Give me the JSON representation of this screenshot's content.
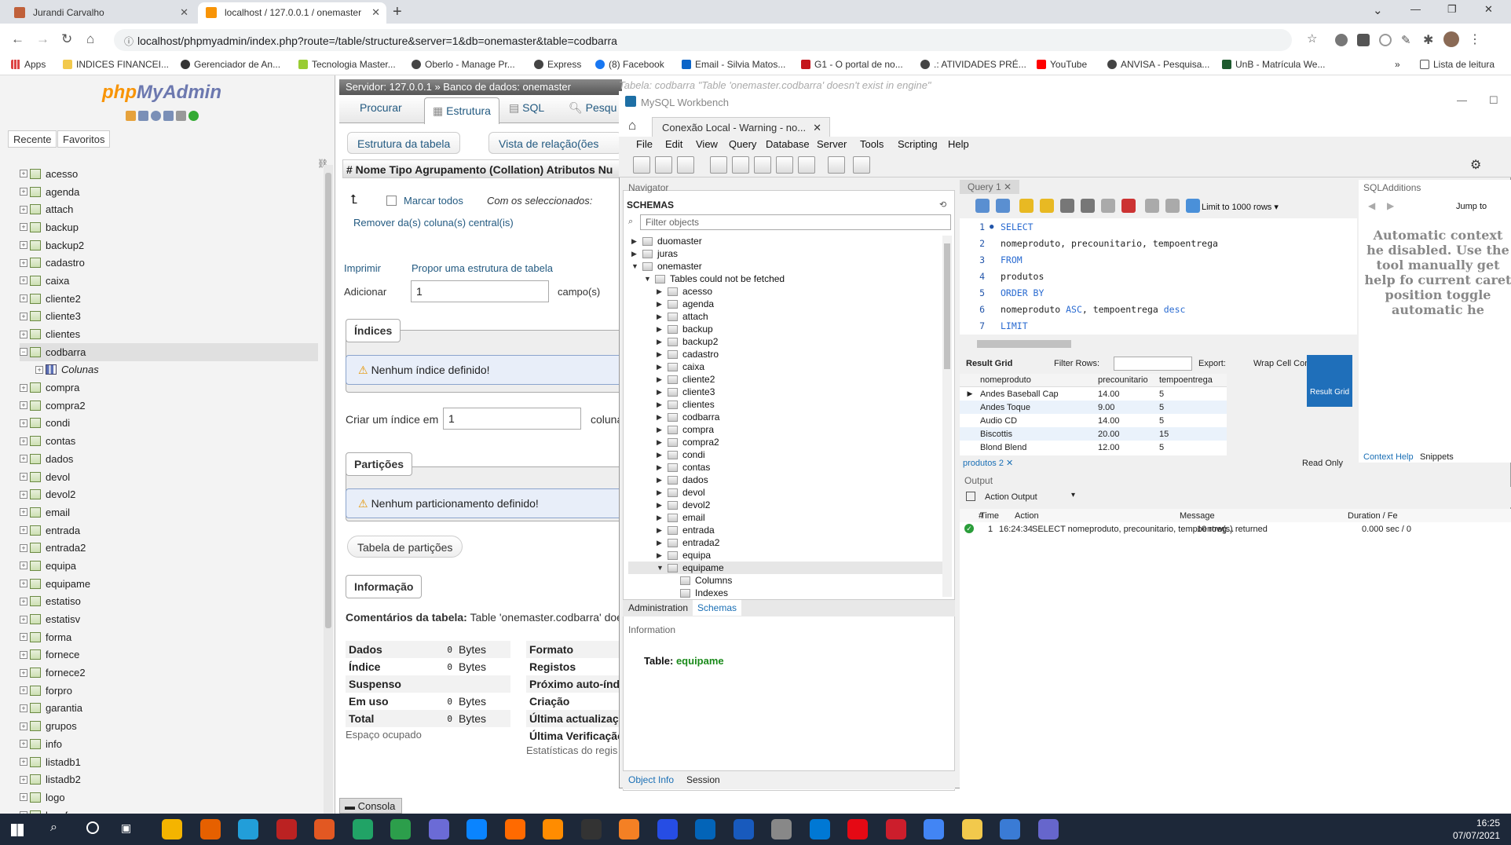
{
  "browser": {
    "tabs": [
      {
        "title": "Jurandi Carvalho"
      },
      {
        "title": "localhost / 127.0.0.1 / onemaster"
      }
    ],
    "url": "localhost/phpmyadmin/index.php?route=/table/structure&server=1&db=onemaster&table=codbarra",
    "bookmarks": [
      "Apps",
      "INDICES FINANCEI...",
      "Gerenciador de An...",
      "Tecnologia Master...",
      "Oberlo - Manage Pr...",
      "Express",
      "(8) Facebook",
      "Email - Silvia Matos...",
      "G1 - O portal de no...",
      ".: ATIVIDADES PRÉ...",
      "YouTube",
      "ANVISA - Pesquisa...",
      "UnB - Matrícula We..."
    ],
    "reading_list": "Lista de leitura"
  },
  "pma": {
    "logo": {
      "php": "php",
      "my": "MyAdmin"
    },
    "recent": "Recente",
    "favorites": "Favoritos",
    "tree": [
      "acesso",
      "agenda",
      "attach",
      "backup",
      "backup2",
      "cadastro",
      "caixa",
      "cliente2",
      "cliente3",
      "clientes",
      "codbarra",
      "Colunas",
      "compra",
      "compra2",
      "condi",
      "contas",
      "dados",
      "devol",
      "devol2",
      "email",
      "entrada",
      "entrada2",
      "equipa",
      "equipame",
      "estatiso",
      "estatisv",
      "forma",
      "fornece",
      "fornece2",
      "forpro",
      "garantia",
      "grupos",
      "info",
      "listadb1",
      "listadb2",
      "logo",
      "logof"
    ],
    "server_bar": "Servidor: 127.0.0.1 » Banco de dados: onemaster",
    "tabs": {
      "browse": "Procurar",
      "structure": "Estrutura",
      "sql": "SQL",
      "search": "Pesqu"
    },
    "sub_tabs": {
      "table_structure": "Estrutura da tabela",
      "relations": "Vista de relação(ões"
    },
    "columns_header": "#  Nome  Tipo  Agrupamento (Collation)  Atributos  Nu",
    "check_all": "Marcar todos",
    "with_selected": "Com os seleccionados:",
    "remove_central": "Remover da(s) coluna(s) central(is)",
    "print": "Imprimir",
    "propose": "Propor uma estrutura de tabela",
    "add": "Adicionar",
    "add_value": "1",
    "fields": "campo(s)",
    "indexes": "Índices",
    "no_index": "Nenhum índice definido!",
    "create_index": "Criar um índice em",
    "create_index_value": "1",
    "create_index_col": "coluna",
    "partitions": "Partições",
    "no_partition": "Nenhum particionamento definido!",
    "partition_table": "Tabela de partições",
    "information": "Informação",
    "comments_label": "Comentários da tabela:",
    "comments_value": "Table 'onemaster.codbarra' doesn'",
    "space_rows": [
      {
        "label": "Dados",
        "value": "0",
        "unit": "Bytes"
      },
      {
        "label": "Índice",
        "value": "0",
        "unit": "Bytes"
      },
      {
        "label": "Suspenso",
        "value": "",
        "unit": ""
      },
      {
        "label": "Em uso",
        "value": "0",
        "unit": "Bytes"
      },
      {
        "label": "Total",
        "value": "0",
        "unit": "Bytes"
      }
    ],
    "space_footer": "Espaço ocupado",
    "row_stats": [
      "Formato",
      "Registos",
      "Próximo auto-índic",
      "Criação",
      "Última actualizaçã",
      "Última Verificação"
    ],
    "row_stats_footer": "Estatísticas do regis",
    "console": "Consola"
  },
  "wb": {
    "title": "MySQL Workbench",
    "overlay_title": "Tabela: codbarra  \"Table 'onemaster.codbarra' doesn't exist in engine\"",
    "conn_tab": "Conexão Local - Warning - no...",
    "menu": [
      "File",
      "Edit",
      "View",
      "Query",
      "Database",
      "Server",
      "Tools",
      "Scripting",
      "Help"
    ],
    "navigator": "Navigator",
    "schemas": "SCHEMAS",
    "filter_placeholder": "Filter objects",
    "schema_list": [
      "duomaster",
      "juras",
      "onemaster"
    ],
    "tables_note": "Tables could not be fetched",
    "tables": [
      "acesso",
      "agenda",
      "attach",
      "backup",
      "backup2",
      "cadastro",
      "caixa",
      "cliente2",
      "cliente3",
      "clientes",
      "codbarra",
      "compra",
      "compra2",
      "condi",
      "contas",
      "dados",
      "devol",
      "devol2",
      "email",
      "entrada",
      "entrada2",
      "equipa",
      "equipame"
    ],
    "equipame_children": [
      "Columns",
      "Indexes"
    ],
    "nav_tabs": {
      "admin": "Administration",
      "schemas": "Schemas"
    },
    "information": "Information",
    "info_table_label": "Table:",
    "info_table_name": "equipame",
    "bottom_tabs": {
      "object_info": "Object Info",
      "session": "Session"
    },
    "query_tab": "Query 1",
    "limit": "Limit to 1000 rows",
    "sql_lines": [
      [
        {
          "t": "SELECT",
          "k": 1
        }
      ],
      [
        {
          "t": "nomeproduto, precounitario, tempoentrega",
          "k": 0
        }
      ],
      [
        {
          "t": "FROM",
          "k": 1
        }
      ],
      [
        {
          "t": "produtos",
          "k": 0
        }
      ],
      [
        {
          "t": "ORDER BY",
          "k": 1
        }
      ],
      [
        {
          "t": "nomeproduto ",
          "k": 0
        },
        {
          "t": "ASC",
          "k": 1
        },
        {
          "t": ", tempoentrega ",
          "k": 0
        },
        {
          "t": "desc",
          "k": 1
        }
      ],
      [
        {
          "t": "LIMIT",
          "k": 1
        }
      ]
    ],
    "result_grid": "Result Grid",
    "filter_rows": "Filter Rows:",
    "export": "Export:",
    "wrap": "Wrap Cell Conte",
    "grid_cols": [
      "nomeproduto",
      "precounitario",
      "tempoentrega"
    ],
    "grid_rows": [
      [
        "Andes Baseball Cap",
        "14.00",
        "5"
      ],
      [
        "Andes Toque",
        "9.00",
        "5"
      ],
      [
        "Audio CD",
        "14.00",
        "5"
      ],
      [
        "Biscottis",
        "20.00",
        "15"
      ],
      [
        "Blond Blend",
        "12.00",
        "5"
      ]
    ],
    "result_side": "Result Grid",
    "result_tab": "produtos 2",
    "read_only": "Read Only",
    "output": "Output",
    "action_output": "Action Output",
    "out_cols": [
      "#",
      "Time",
      "Action",
      "Message",
      "Duration / Fe"
    ],
    "out_row": [
      "1",
      "16:24:34",
      "SELECT nomeproduto, precounitario, tempoentreg...",
      "10 row(s) returned",
      "0.000 sec / 0"
    ],
    "sql_additions": "SQLAdditions",
    "jump_to": "Jump to",
    "context_help_text": "Automatic context he disabled. Use the tool manually get help fo current caret position toggle automatic he",
    "context_help": "Context Help",
    "snippets": "Snippets"
  },
  "taskbar": {
    "time": "16:25",
    "date": "07/07/2021"
  }
}
